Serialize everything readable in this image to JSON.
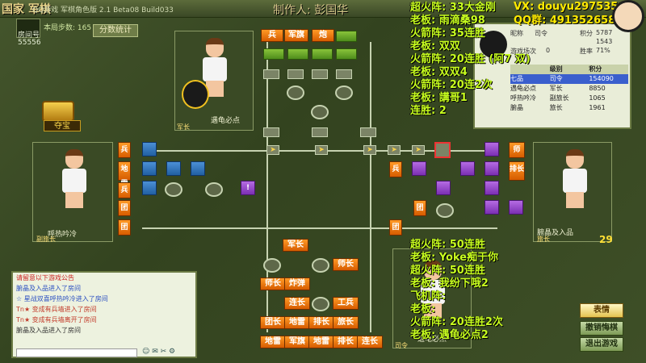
{
  "window": {
    "title": "国家 军棋",
    "build": "QQ游戏 军棋角色版 2.1 Beta08 Build033",
    "maker": "制作人: 彭国华"
  },
  "status": {
    "steps": "本局步数: 165",
    "room_label": "房间号",
    "room_number": "55556",
    "stats_button": "分数统计"
  },
  "treasure": {
    "label": "夺宝"
  },
  "players": {
    "top": {
      "name": "遇龟必点",
      "rank": "军长"
    },
    "left": {
      "name": "呼热吟冷",
      "rank": "副旅长"
    },
    "right": {
      "name": "腑晶及入品",
      "rank": "旅长"
    },
    "bottom": {
      "name": "遇龟必点",
      "rank": "司令"
    }
  },
  "board": {
    "top_pieces": [
      "兵",
      "军旗",
      "炮"
    ],
    "left_pieces": [
      "兵",
      "地雷",
      "兵",
      "团",
      "团"
    ],
    "right_pieces": [
      "师",
      "排长"
    ],
    "right_inner": [
      "兵",
      "团",
      "团"
    ],
    "bottom_pieces": [
      [
        "军长"
      ],
      [
        "师长"
      ],
      [
        "师长",
        "炸弹"
      ],
      [
        "连长",
        "工兵"
      ],
      [
        "团长",
        "地雷",
        "排长",
        "旅长"
      ],
      [
        "地雷",
        "军旗",
        "地雷",
        "排长",
        "连长"
      ]
    ],
    "bang": "!",
    "arrow": "➤"
  },
  "scoreboard": {
    "nick_label": "昵称",
    "team_label": "司令",
    "points_label": "积分",
    "points_value": "5787",
    "id_value": "1543",
    "games_label": "游戏场次",
    "games_value": "0",
    "rate_label": "胜率",
    "rate_value": "71%",
    "columns": [
      "",
      "级别",
      "积分"
    ],
    "rows": [
      {
        "name": "七品",
        "rank": "司令",
        "score": "154090"
      },
      {
        "name": "遇龟必点",
        "rank": "军长",
        "score": "8850"
      },
      {
        "name": "呼热吟冷",
        "rank": "副旅长",
        "score": "1065"
      },
      {
        "name": "腑晶",
        "rank": "旅长",
        "score": "1961"
      }
    ]
  },
  "overlay_top": [
    "超火阵: 33大金刚",
    "老板: 雨滴桑98",
    "火箭阵: 35连胜",
    "老板: 双双",
    "火箭阵: 20连胜 (阿7 双)",
    "老板: 双双4",
    "火箭阵: 20连2次",
    "老板: 講哥1",
    "连胜: 2"
  ],
  "overlay_bottom": [
    "超火阵: 50连胜",
    "老板: Yoke痴于你",
    "超火阵: 50连胜",
    "老板: 我纷下哦2",
    "飞机阵:",
    "老板:",
    "火箭阵: 20连胜2次",
    "老板: 遇龟必点2"
  ],
  "contact": {
    "vx": "VX: douyu297535",
    "qq": "QQ群: 491352658"
  },
  "chat": {
    "title": "请留意以下游戏公告",
    "lines": [
      "腑晶及入品进入了房间",
      "☆ 星战双喜呼热吟冷进入了房间",
      "Tn★ 变成有兵墙进入了房间",
      "Tn★ 变成有兵墙离开了房间",
      "腑晶及入品进入了房间"
    ],
    "icons": "☺ ✉ ✂ ⚙"
  },
  "side": {
    "emote_button": "表情",
    "btn_cancel": "撤销悔棋",
    "btn_exit": "退出游戏",
    "count": "29"
  }
}
